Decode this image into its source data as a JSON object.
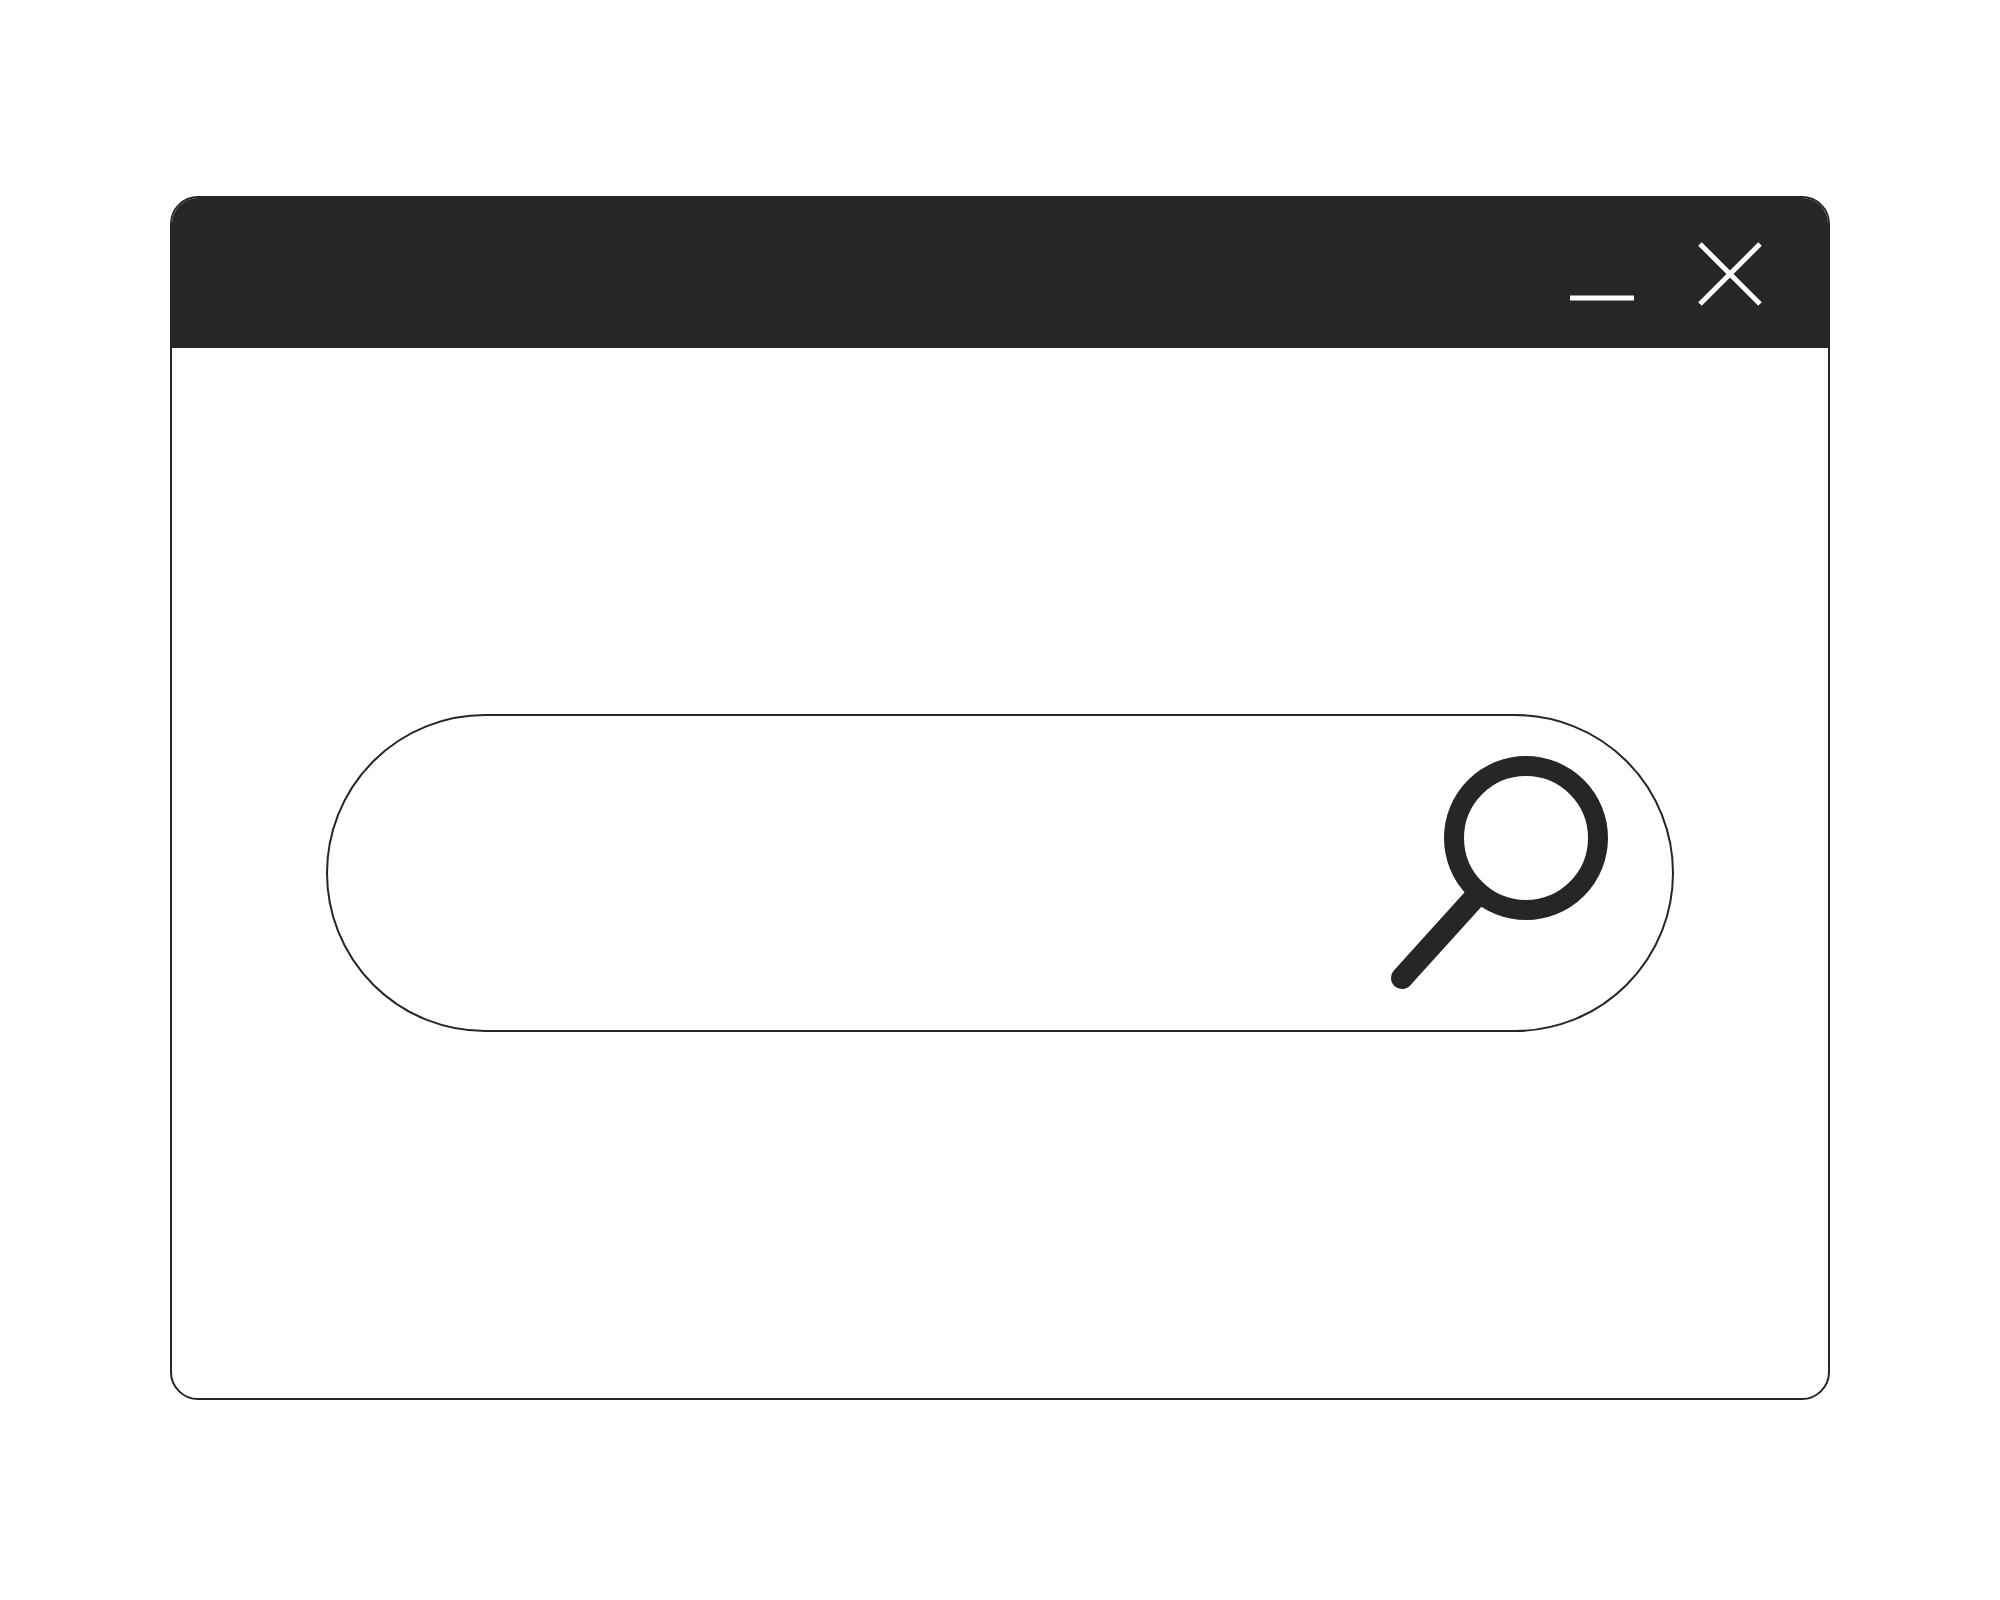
{
  "title_bar": {
    "buttons": [
      {
        "kind": "minimize"
      },
      {
        "kind": "close"
      }
    ]
  },
  "search_field": {
    "kind": "pill"
  }
}
